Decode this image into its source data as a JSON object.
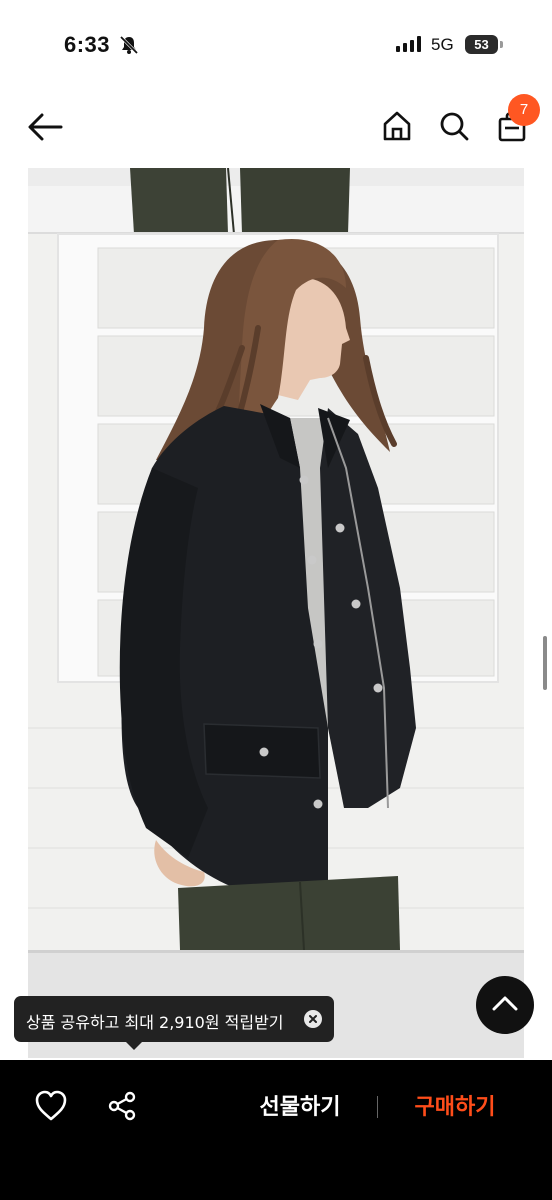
{
  "status_bar": {
    "time": "6:33",
    "network": "5G",
    "battery": "53"
  },
  "nav": {
    "cart_count": "7",
    "icons": [
      "back-arrow-icon",
      "home-icon",
      "search-icon",
      "shopping-bag-icon"
    ]
  },
  "product": {
    "image_alt": "model wearing black oversized cotton jacket with grey sweater and dark green trousers"
  },
  "toast": {
    "text": "상품 공유하고 최대 2,910원 적립받기"
  },
  "bottom_bar": {
    "gift_label": "선물하기",
    "buy_label": "구매하기"
  },
  "colors": {
    "accent": "#ff5722",
    "buy": "#ff4d1a",
    "bottom_bar": "#000000"
  }
}
